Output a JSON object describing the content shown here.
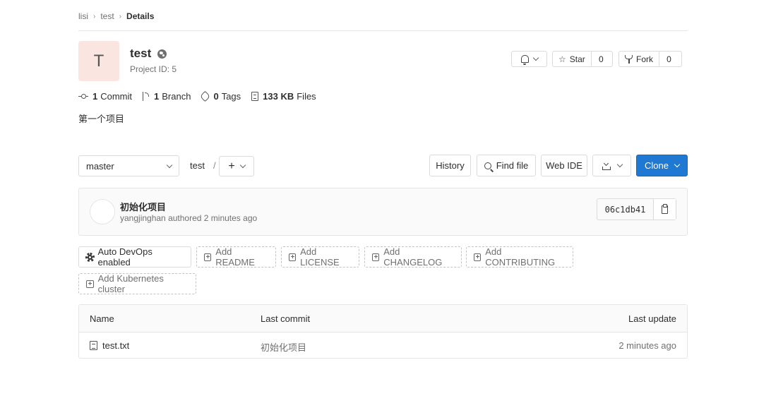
{
  "breadcrumb": {
    "items": [
      "lisi",
      "test"
    ],
    "current": "Details"
  },
  "project": {
    "avatar_letter": "T",
    "name": "test",
    "id_label": "Project ID: 5",
    "description": "第一个项目"
  },
  "actions": {
    "star_label": "Star",
    "star_count": "0",
    "fork_label": "Fork",
    "fork_count": "0"
  },
  "stats": [
    {
      "icon": "commit-icon",
      "value": "1",
      "label": "Commit"
    },
    {
      "icon": "branch-icon",
      "value": "1",
      "label": "Branch"
    },
    {
      "icon": "tag-icon",
      "value": "0",
      "label": "Tags"
    },
    {
      "icon": "file-icon",
      "value": "133 KB",
      "label": "Files"
    }
  ],
  "repo": {
    "branch": "master",
    "path": "test",
    "path_sep": "/",
    "add_label": "+",
    "history_label": "History",
    "find_file_label": "Find file",
    "web_ide_label": "Web IDE",
    "clone_label": "Clone"
  },
  "commit": {
    "title": "初始化项目",
    "author": "yangjinghan",
    "meta": "authored 2 minutes ago",
    "sha": "06c1db41"
  },
  "quick_actions": [
    "Auto DevOps enabled",
    "Add README",
    "Add LICENSE",
    "Add CHANGELOG",
    "Add CONTRIBUTING",
    "Add Kubernetes cluster"
  ],
  "table": {
    "headers": {
      "name": "Name",
      "last_commit": "Last commit",
      "last_update": "Last update"
    },
    "rows": [
      {
        "name": "test.txt",
        "last_commit": "初始化项目",
        "last_update": "2 minutes ago"
      }
    ]
  },
  "colors": {
    "primary": "#1f78d1",
    "avatar_bg": "#fbe5e1"
  }
}
